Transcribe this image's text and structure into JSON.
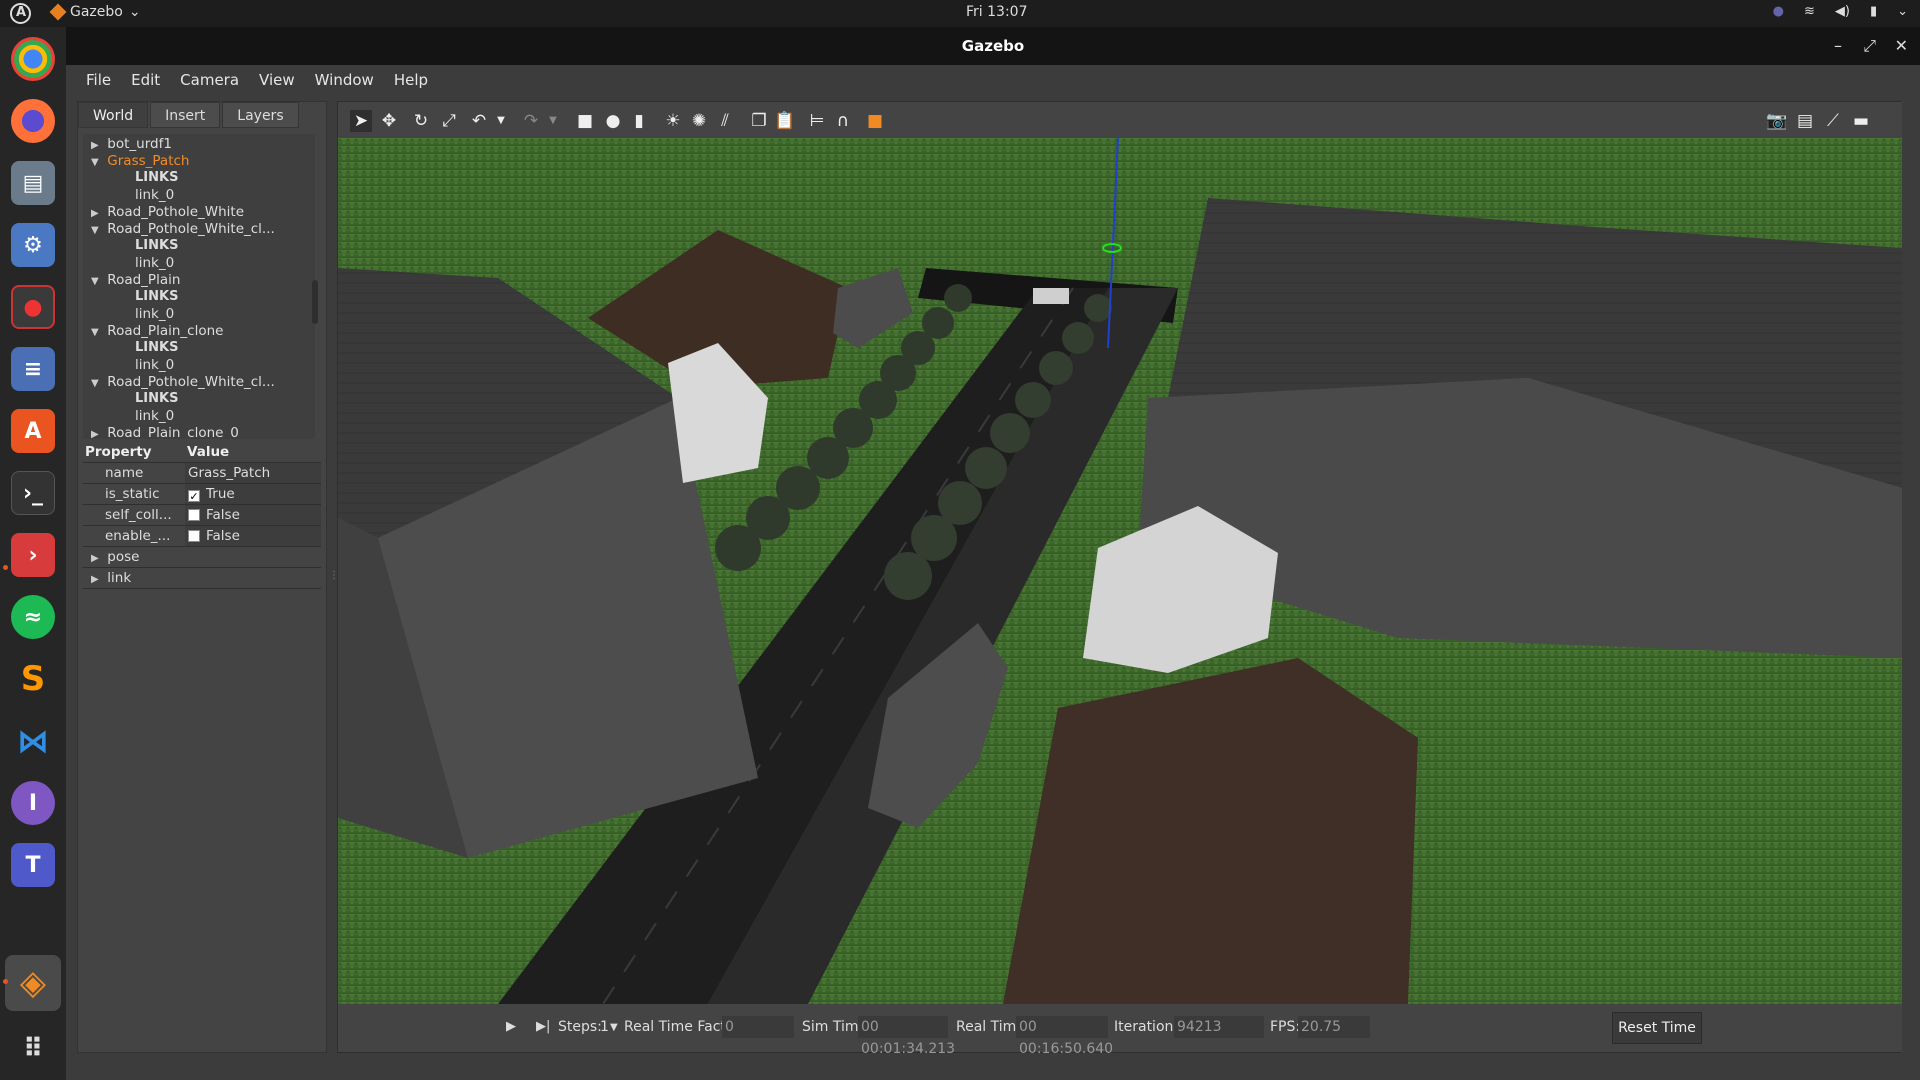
{
  "topbar": {
    "app_name": "Gazebo",
    "clock": "Fri 13:07"
  },
  "window": {
    "title": "Gazebo"
  },
  "menu": [
    "File",
    "Edit",
    "Camera",
    "View",
    "Window",
    "Help"
  ],
  "left_tabs": [
    "World",
    "Insert",
    "Layers"
  ],
  "tree": {
    "items": [
      {
        "label": "bot_urdf1",
        "arrow": "▶"
      },
      {
        "label": "Grass_Patch",
        "arrow": "▼"
      },
      {
        "label": "LINKS"
      },
      {
        "label": "link_0"
      },
      {
        "label": "Road_Pothole_White",
        "arrow": "▶"
      },
      {
        "label": "Road_Pothole_White_cl...",
        "arrow": "▼"
      },
      {
        "label": "LINKS"
      },
      {
        "label": "link_0"
      },
      {
        "label": "Road_Plain",
        "arrow": "▼"
      },
      {
        "label": "LINKS"
      },
      {
        "label": "link_0"
      },
      {
        "label": "Road_Plain_clone",
        "arrow": "▼"
      },
      {
        "label": "LINKS"
      },
      {
        "label": "link_0"
      },
      {
        "label": "Road_Pothole_White_cl...",
        "arrow": "▼"
      },
      {
        "label": "LINKS"
      },
      {
        "label": "link_0"
      },
      {
        "label": "Road_Plain_clone_0",
        "arrow": "▶"
      }
    ]
  },
  "props": {
    "header_property": "Property",
    "header_value": "Value",
    "rows": [
      {
        "name": "name",
        "value": "Grass_Patch"
      },
      {
        "name": "is_static",
        "value": "True",
        "checked": true
      },
      {
        "name": "self_coll...",
        "value": "False",
        "checked": false
      },
      {
        "name": "enable_...",
        "value": "False",
        "checked": false
      }
    ],
    "expand_pose": "pose",
    "expand_link": "link"
  },
  "bottom": {
    "steps_label": "Steps:",
    "steps_value": "1",
    "rtf_label": "Real Time Factor:",
    "rtf_value": "0",
    "sim_label": "Sim Time:",
    "sim_value": "00 00:01:34.213",
    "real_label": "Real Time:",
    "real_value": "00 00:16:50.640",
    "iter_label": "Iterations:",
    "iter_value": "94213",
    "fps_label": "FPS:",
    "fps_value": "20.75",
    "reset_label": "Reset Time"
  },
  "colors": {
    "selected": "#f28c28",
    "grass": "#3e6a2e",
    "road": "#1e1e1e"
  }
}
